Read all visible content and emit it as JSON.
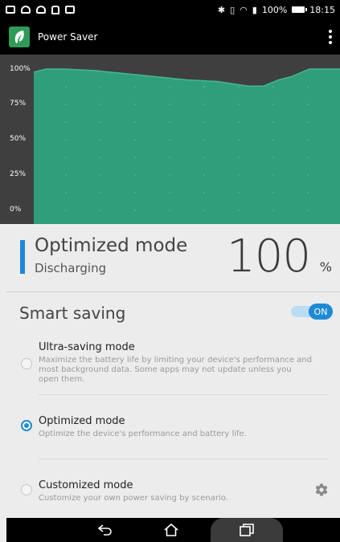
{
  "status_bar": {
    "left_icons": [
      "notification-icon",
      "cloud-icon",
      "cloud-upload-icon",
      "lock-icon",
      "briefcase-icon"
    ],
    "right_icons": [
      "bluetooth-icon",
      "vibrate-icon",
      "wifi-icon",
      "battery-saver-icon"
    ],
    "battery": "100%",
    "time": "18:15"
  },
  "app_bar": {
    "title": "Power Saver",
    "logo_icon": "leaf-icon",
    "menu_icon": "more-vert-icon"
  },
  "chart_data": {
    "type": "area",
    "x": [
      0,
      4,
      10,
      20,
      30,
      40,
      50,
      60,
      70,
      75,
      80,
      84,
      90,
      100
    ],
    "series": [
      {
        "values": [
          98,
          100,
          100,
          99,
          97,
          95,
          93,
          92,
          89,
          89,
          93,
          95,
          100,
          100
        ],
        "color": "#2e9e7b"
      }
    ],
    "y_ticks": [
      "100%",
      "75%",
      "50%",
      "25%",
      "0%"
    ],
    "ylim": [
      0,
      100
    ],
    "grid": true,
    "background": "#3f3f3f"
  },
  "status": {
    "mode": "Optimized mode",
    "state": "Discharging",
    "percent": "100",
    "percent_unit": "%",
    "accent": "#1f88d6"
  },
  "smart_saving": {
    "title": "Smart saving",
    "toggle_label": "ON",
    "toggle_on": true,
    "options": [
      {
        "title": "Ultra-saving mode",
        "description": "Maximize the battery life by limiting your device's performance and most background data. Some apps may not update unless you open them.",
        "selected": false
      },
      {
        "title": "Optimized mode",
        "description": "Optimize the device's performance and battery life.",
        "selected": true
      },
      {
        "title": "Customized mode",
        "description": "Customize your own power saving by scenario.",
        "selected": false,
        "settings_icon": "gear-icon"
      }
    ]
  },
  "nav_bar": {
    "buttons": [
      "back-icon",
      "home-icon",
      "recent-apps-icon"
    ]
  }
}
